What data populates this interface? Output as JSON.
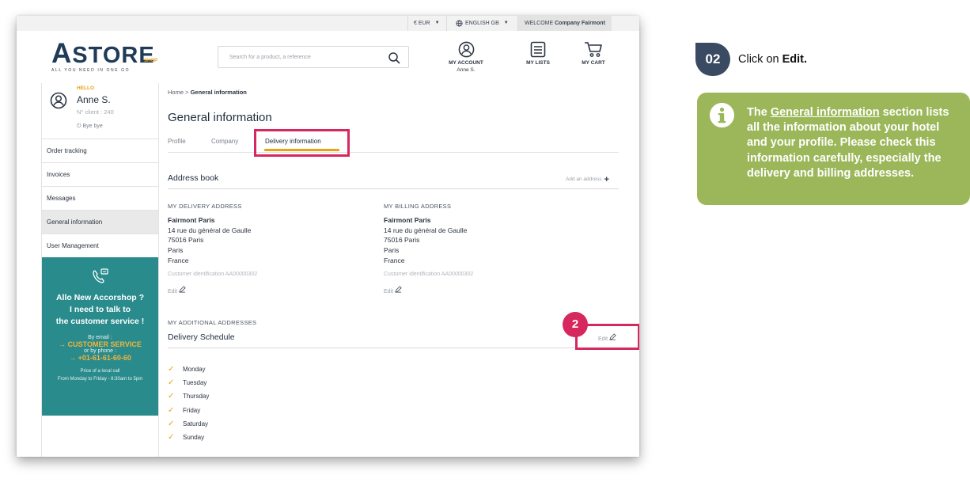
{
  "topbar": {
    "currency": "€ EUR",
    "language": "ENGLISH GB",
    "welcome_prefix": "WELCOME",
    "welcome_company": "Company Fairmont"
  },
  "logo": {
    "brand_first": "A",
    "brand_rest": "STORE",
    "shop": "SHOP",
    "tagline": "ALL YOU NEED IN ONE GO"
  },
  "search": {
    "placeholder": "Search for a product, a reference"
  },
  "header": {
    "account_label": "MY ACCOUNT",
    "account_user": "Anne S.",
    "lists_label": "MY LISTS",
    "cart_label": "MY CART"
  },
  "profile": {
    "hello": "HELLO",
    "name": "Anne S.",
    "client": "N° client : 240",
    "logout": "Bye bye"
  },
  "sidebar": {
    "items": [
      {
        "label": "Order tracking"
      },
      {
        "label": "Invoices"
      },
      {
        "label": "Messages"
      },
      {
        "label": "General information"
      },
      {
        "label": "User Management"
      }
    ]
  },
  "promo": {
    "line1": "Allo New Accorshop ?",
    "line2": "I need to talk to",
    "line3": "the customer service !",
    "by_email": "By email :",
    "customer_service": "CUSTOMER SERVICE",
    "by_phone": "or by phone :",
    "phone": "+01-61-61-60-60",
    "price_note": "Price of a local call",
    "hours": "From Monday to Friday - 8:30am to 5pm"
  },
  "breadcrumb": {
    "home": "Home",
    "separator": ">",
    "current": "General information"
  },
  "page_title": "General information",
  "tabs": [
    {
      "label": "Profile"
    },
    {
      "label": "Company"
    },
    {
      "label": "Delivery information"
    }
  ],
  "address_book": {
    "title": "Address book",
    "add_label": "Add an address",
    "delivery": {
      "caption": "MY DELIVERY ADDRESS",
      "name": "Fairmont Paris",
      "street": "14 rue du général de Gaulle",
      "zip": "75016 Paris",
      "city": "Paris",
      "country": "France",
      "customer_id": "Customer identification AA00000302",
      "edit": "Edit"
    },
    "billing": {
      "caption": "MY BILLING ADDRESS",
      "name": "Fairmont Paris",
      "street": "14 rue du général de Gaulle",
      "zip": "75016 Paris",
      "city": "Paris",
      "country": "France",
      "customer_id": "Customer identification AA00000302",
      "edit": "Edit"
    }
  },
  "additional_addresses": "MY ADDITIONAL ADDRESSES",
  "schedule": {
    "title": "Delivery Schedule",
    "edit": "Edit",
    "days": [
      "Monday",
      "Tuesday",
      "Thursday",
      "Friday",
      "Saturday",
      "Sunday"
    ]
  },
  "callout_marker": "2",
  "instruction": {
    "step": "02",
    "prefix": "Click on",
    "action": "Edit."
  },
  "note": {
    "part1": "The",
    "link": "General information",
    "part2": "section lists all the information about your hotel and your profile. Please check this information carefully, especially the delivery and billing addresses."
  },
  "colors": {
    "accent": "#e8a317",
    "navy": "#1f3b57",
    "teal": "#2a8b8c",
    "highlight": "#d6285e",
    "note_green": "#9bb75a",
    "step_badge": "#3a4a63"
  }
}
